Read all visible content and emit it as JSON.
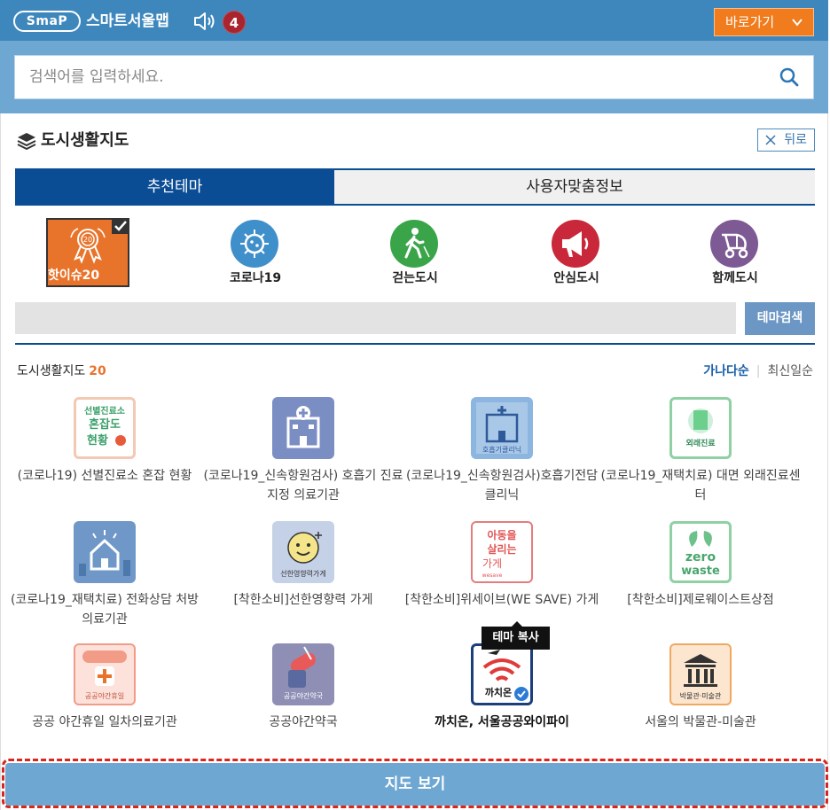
{
  "header": {
    "logo_text": "SmaP",
    "app_title": "스마트서울맵",
    "notification_count": "4",
    "quick_menu_label": "바로가기"
  },
  "search": {
    "placeholder": "검색어를 입력하세요."
  },
  "panel": {
    "title": "도시생활지도",
    "back_label": "뒤로",
    "tabs": [
      {
        "label": "추천테마",
        "active": true
      },
      {
        "label": "사용자맞춤정보",
        "active": false
      }
    ],
    "theme_categories": [
      {
        "label": "핫이슈20",
        "icon": "medal-icon",
        "color": "#e8742c",
        "selected": true
      },
      {
        "label": "코로나19",
        "icon": "virus-icon",
        "color": "#3f8fcb",
        "selected": false
      },
      {
        "label": "걷는도시",
        "icon": "walking-person-icon",
        "color": "#3aa548",
        "selected": false
      },
      {
        "label": "안심도시",
        "icon": "megaphone-icon",
        "color": "#c9283a",
        "selected": false
      },
      {
        "label": "함께도시",
        "icon": "stroller-icon",
        "color": "#7d5a94",
        "selected": false
      }
    ],
    "theme_search_button": "테마검색",
    "list_title": "도시생활지도",
    "list_count": "20",
    "sort_options": [
      "가나다순",
      "최신일순"
    ],
    "items": [
      {
        "label": "(코로나19) 선별진료소 혼잡 현황",
        "icon_text": "선별진료소 혼잡도 현황",
        "icon": "clinic-congestion-icon"
      },
      {
        "label": "(코로나19_신속항원검사) 호흡기 진료 지정 의료기관",
        "icon_text": "",
        "icon": "hospital-icon"
      },
      {
        "label": "(코로나19_신속항원검사)호흡기전담클리닉",
        "icon_text": "호흡기클리닉",
        "icon": "respiratory-clinic-icon"
      },
      {
        "label": "(코로나19_재택치료) 대면 외래진료센터",
        "icon_text": "외래진료",
        "icon": "outpatient-center-icon"
      },
      {
        "label": "(코로나19_재택치료) 전화상담 처방 의료기관",
        "icon_text": "",
        "icon": "phone-consult-house-icon"
      },
      {
        "label": "[착한소비]선한영향력 가게",
        "icon_text": "선한영향력가게",
        "icon": "good-influence-store-icon"
      },
      {
        "label": "[착한소비]위세이브(WE SAVE) 가게",
        "icon_text": "아동을 살리는 가게",
        "icon": "wesave-store-icon"
      },
      {
        "label": "[착한소비]제로웨이스트상점",
        "icon_text": "zero waste",
        "icon": "zero-waste-icon"
      },
      {
        "label": "공공 야간휴일 일차의료기관",
        "icon_text": "공공야간휴일",
        "icon": "night-clinic-icon"
      },
      {
        "label": "공공야간약국",
        "icon_text": "공공야간약국",
        "icon": "night-pharmacy-icon"
      },
      {
        "label": "까치온, 서울공공와이파이",
        "icon_text": "까치온",
        "icon": "wifi-icon"
      },
      {
        "label": "서울의 박물관-미술관",
        "icon_text": "박물관·미술관",
        "icon": "museum-icon"
      }
    ],
    "tooltip": "테마 복사",
    "map_button": "지도 보기"
  }
}
